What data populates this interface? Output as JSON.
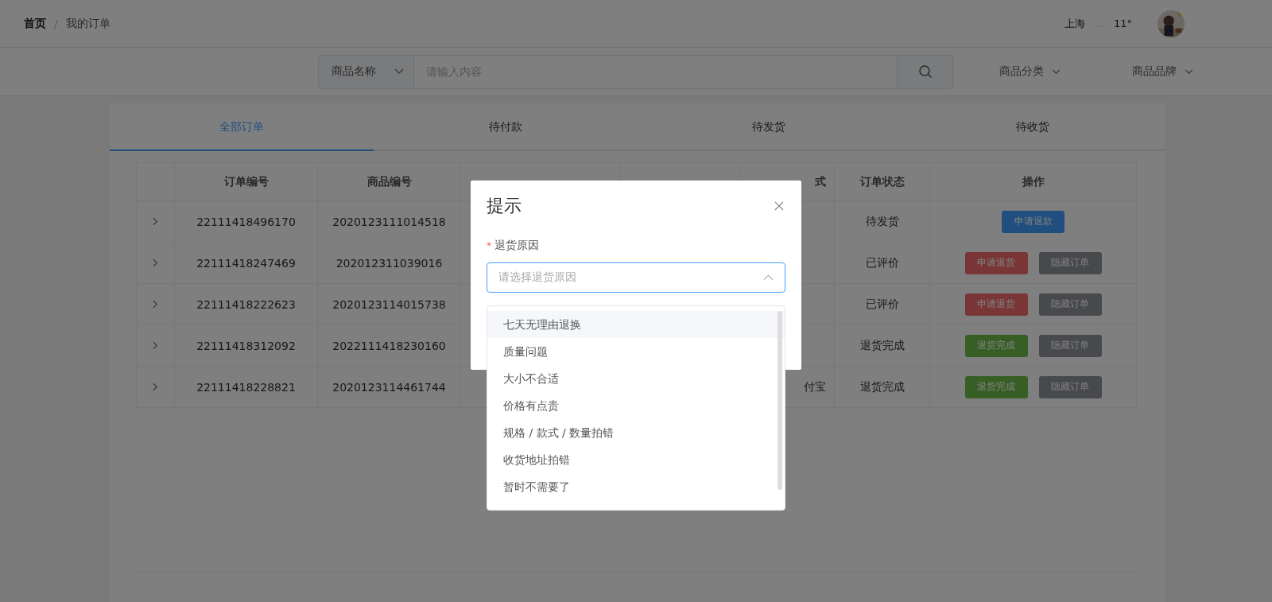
{
  "breadcrumb": [
    {
      "label": "首页",
      "current": false
    },
    {
      "label": "我的订单",
      "current": true
    }
  ],
  "breadcrumb_separator": "/",
  "weather": {
    "city": "上海",
    "status": "...",
    "temperature": "11°"
  },
  "search": {
    "category": "商品名称",
    "placeholder": "请输入内容"
  },
  "filters": [
    {
      "label": "商品分类"
    },
    {
      "label": "商品品牌"
    }
  ],
  "tabs": [
    {
      "label": "全部订单",
      "selected": true
    },
    {
      "label": "待付款",
      "selected": false
    },
    {
      "label": "待发货",
      "selected": false
    },
    {
      "label": "待收货",
      "selected": false
    }
  ],
  "table": {
    "columns": [
      {
        "kind": "expand"
      },
      {
        "kind": "text",
        "label": "订单编号"
      },
      {
        "kind": "text",
        "label": "商品编号"
      },
      {
        "kind": "covered"
      },
      {
        "kind": "covered"
      },
      {
        "kind": "partial",
        "label": "式"
      },
      {
        "kind": "text",
        "label": "订单状态"
      },
      {
        "kind": "text",
        "label": "操作"
      }
    ],
    "rows": [
      {
        "order_no": "22111418496170",
        "product_no": "2020123111014518",
        "status": "待发货",
        "actions": [
          {
            "label": "申请退款",
            "kind": "refund"
          }
        ]
      },
      {
        "order_no": "22111418247469",
        "product_no": "202012311039016",
        "status": "已评价",
        "actions": [
          {
            "label": "申请退货",
            "kind": "return"
          },
          {
            "label": "隐藏订单",
            "kind": "hide"
          }
        ]
      },
      {
        "order_no": "22111418222623",
        "product_no": "2020123114015738",
        "status": "已评价",
        "actions": [
          {
            "label": "申请退货",
            "kind": "return"
          },
          {
            "label": "隐藏订单",
            "kind": "hide"
          }
        ]
      },
      {
        "order_no": "22111418312092",
        "product_no": "2022111418230160",
        "status": "退货完成",
        "actions": [
          {
            "label": "退货完成",
            "kind": "done"
          },
          {
            "label": "隐藏订单",
            "kind": "hide"
          }
        ]
      },
      {
        "order_no": "22111418228821",
        "product_no": "2020123114461744",
        "payment_fragment": "付宝",
        "status": "退货完成",
        "actions": [
          {
            "label": "退货完成",
            "kind": "done"
          },
          {
            "label": "隐藏订单",
            "kind": "hide"
          }
        ]
      }
    ]
  },
  "dialog": {
    "title": "提示",
    "field": {
      "required_mark": "*",
      "label": "退货原因",
      "placeholder": "请选择退货原因",
      "open": true
    },
    "options": [
      {
        "label": "七天无理由退换",
        "highlighted": true
      },
      {
        "label": "质量问题",
        "highlighted": false
      },
      {
        "label": "大小不合适",
        "highlighted": false
      },
      {
        "label": "价格有点贵",
        "highlighted": false
      },
      {
        "label": "规格 / 款式 / 数量拍错",
        "highlighted": false
      },
      {
        "label": "收货地址拍错",
        "highlighted": false
      },
      {
        "label": "暂时不需要了",
        "highlighted": false
      }
    ]
  }
}
